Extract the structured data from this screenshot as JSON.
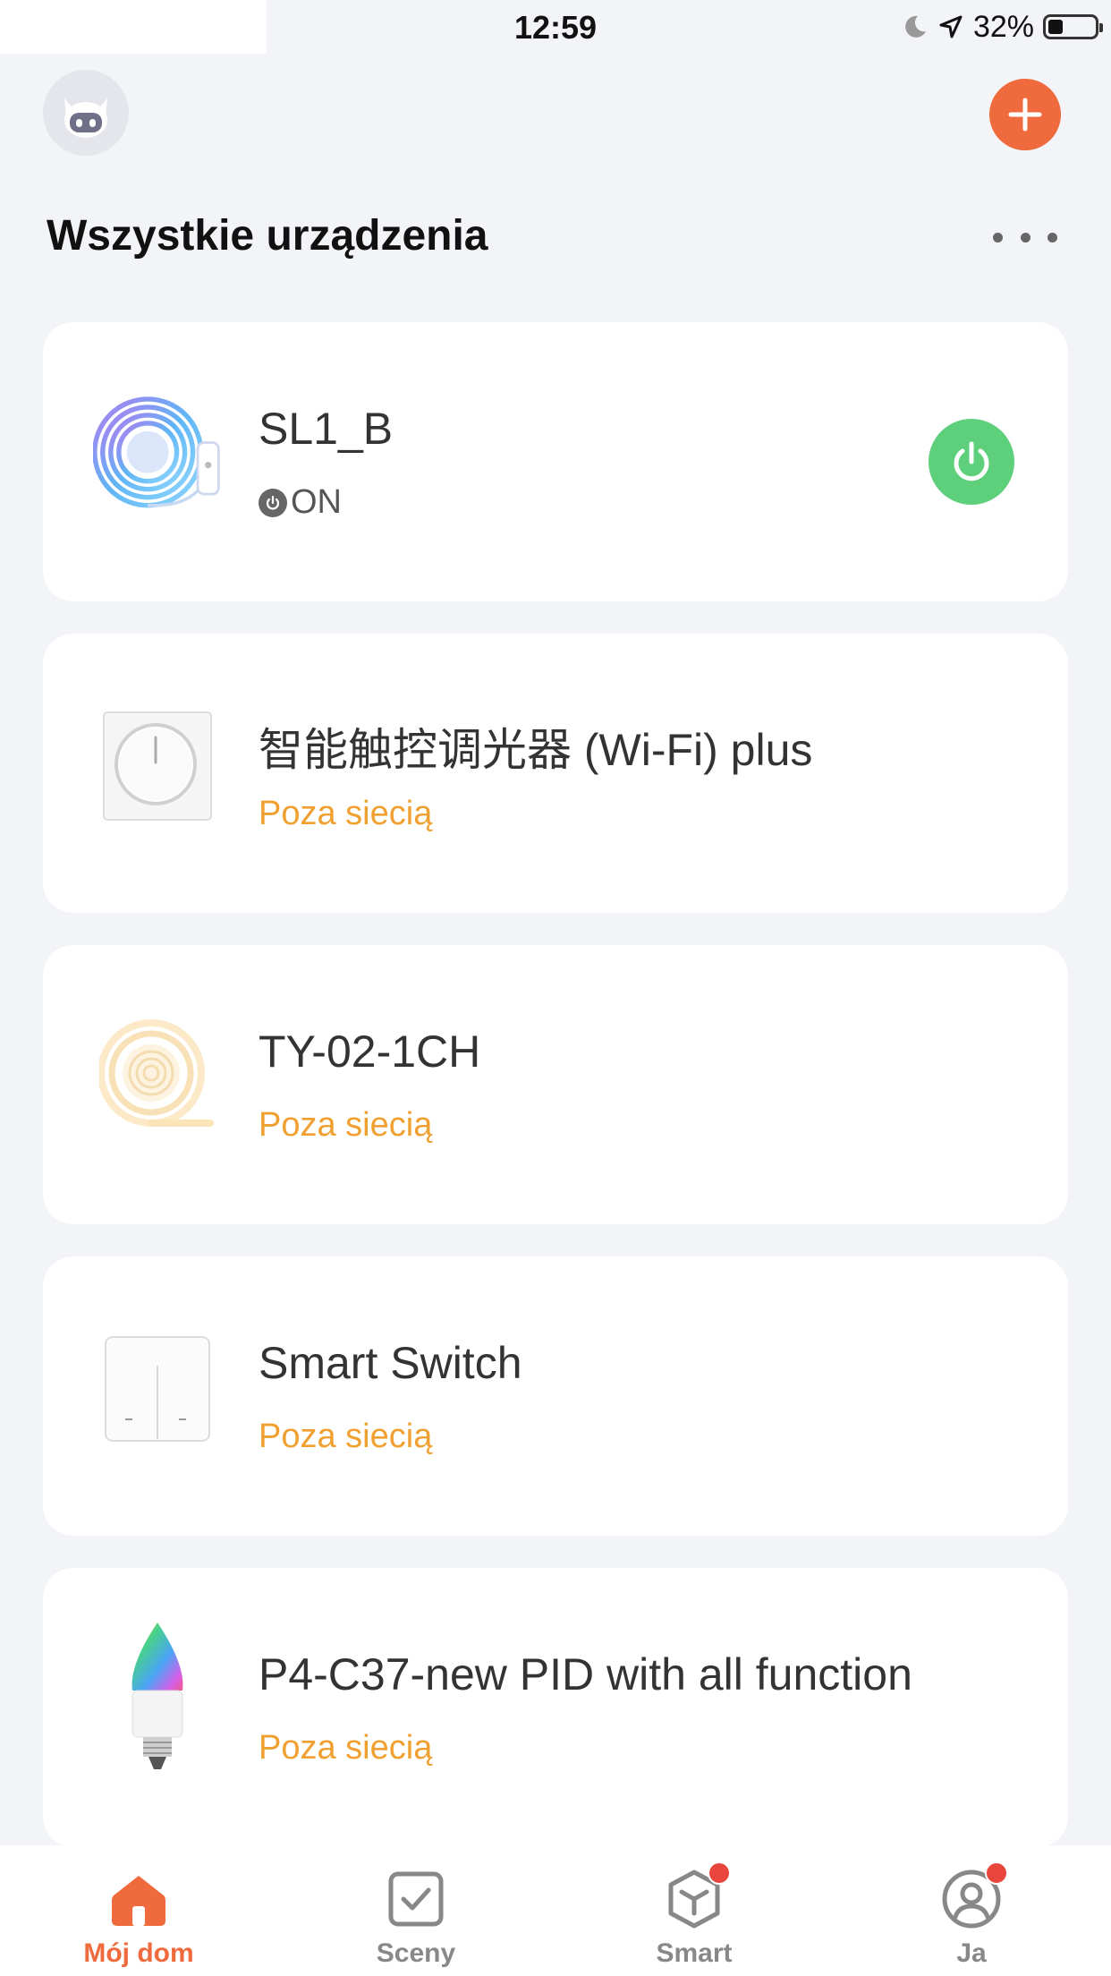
{
  "status_bar": {
    "time": "12:59",
    "battery": "32%",
    "battery_level": 0.32
  },
  "header": {
    "title": "Wszystkie urządzenia",
    "accent_color": "#ef6a3c"
  },
  "devices": [
    {
      "name": "SL1_B",
      "status": "ON",
      "thumb_icon": "led-strip-rgb-icon",
      "state": "on"
    },
    {
      "name": "智能触控调光器 (Wi-Fi) plus",
      "status": "Poza siecią",
      "thumb_icon": "dimmer-switch-icon",
      "state": "offline"
    },
    {
      "name": "TY-02-1CH",
      "status": "Poza siecią",
      "thumb_icon": "led-strip-warm-icon",
      "state": "offline"
    },
    {
      "name": "Smart Switch",
      "status": "Poza siecią",
      "thumb_icon": "double-wall-switch-icon",
      "state": "offline"
    },
    {
      "name": "P4-C37-new PID with all function",
      "status": "Poza siecią",
      "thumb_icon": "candle-bulb-icon",
      "state": "offline"
    }
  ],
  "colors": {
    "online_power": "#5ed07c",
    "offline_status": "#f0a030",
    "badge": "#e8463c"
  },
  "tabs": [
    {
      "label": "Mój dom",
      "icon": "home-icon",
      "active": true,
      "badge": false
    },
    {
      "label": "Sceny",
      "icon": "scenes-checkbox-icon",
      "active": false,
      "badge": false
    },
    {
      "label": "Smart",
      "icon": "smart-cube-icon",
      "active": false,
      "badge": true
    },
    {
      "label": "Ja",
      "icon": "profile-icon",
      "active": false,
      "badge": true
    }
  ]
}
